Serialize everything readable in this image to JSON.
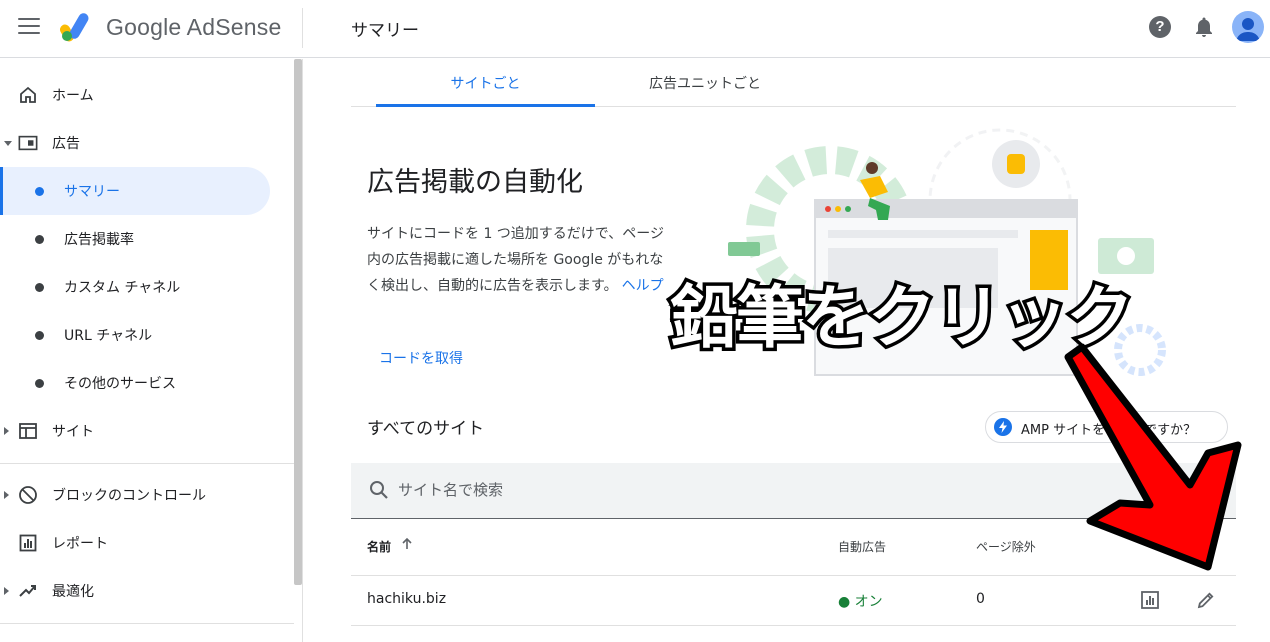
{
  "header": {
    "brand": "Google AdSense",
    "page_title": "サマリー",
    "help_glyph": "?"
  },
  "sidebar": {
    "items": [
      {
        "label": "ホーム"
      },
      {
        "label": "広告"
      },
      {
        "label": "サマリー"
      },
      {
        "label": "広告掲載率"
      },
      {
        "label": "カスタム チャネル"
      },
      {
        "label": "URL チャネル"
      },
      {
        "label": "その他のサービス"
      },
      {
        "label": "サイト"
      },
      {
        "label": "ブロックのコントロール"
      },
      {
        "label": "レポート"
      },
      {
        "label": "最適化"
      }
    ]
  },
  "tabs": [
    {
      "label": "サイトごと"
    },
    {
      "label": "広告ユニットごと"
    }
  ],
  "hero": {
    "title": "広告掲載の自動化",
    "description": "サイトにコードを 1 つ追加するだけで、ページ内の広告掲載に適した場所を Google がもれなく検出し、自動的に広告を表示します。",
    "help_link": "ヘルプ",
    "get_code": "コードを取得"
  },
  "overlay": {
    "text": "鉛筆をクリック"
  },
  "sites": {
    "title": "すべてのサイト",
    "amp_chip": "AMP サイトをお持ちですか？",
    "search_placeholder": "サイト名で検索",
    "columns": {
      "name": "名前",
      "auto_ads": "自動広告",
      "excluded": "ページ除外"
    },
    "rows": [
      {
        "name": "hachiku.biz",
        "auto_ads": "● オン",
        "excluded": "0"
      }
    ]
  },
  "colors": {
    "accent": "#1a73e8",
    "overlay_arrow": "#ff0000",
    "status_on": "#188038"
  }
}
